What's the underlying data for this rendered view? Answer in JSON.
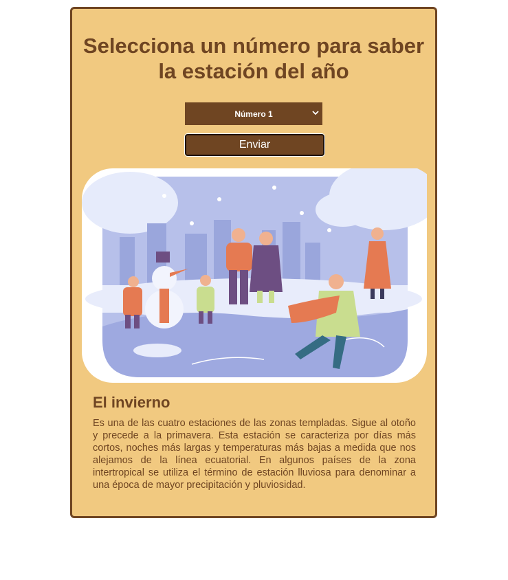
{
  "header": {
    "title": "Selecciona un número para saber la estación del año"
  },
  "form": {
    "select_value": "Número 1",
    "submit_label": "Enviar"
  },
  "illustration": {
    "icon": "winter-skating-scene-illustration"
  },
  "result": {
    "season_title": "El invierno",
    "description": "Es una de las cuatro estaciones de las zonas templadas. Sigue al otoño y precede a la primavera. Esta estación se caracteriza por días más cortos, noches más largas y temperaturas más bajas a medida que nos alejamos de la línea ecuatorial. En algunos países de la zona intertropical se utiliza el término de estación lluviosa para denominar a una época de mayor precipitación y pluviosidad."
  },
  "colors": {
    "card_bg": "#f1c980",
    "brand_brown": "#6f4522",
    "ice": "#a2aee0"
  }
}
